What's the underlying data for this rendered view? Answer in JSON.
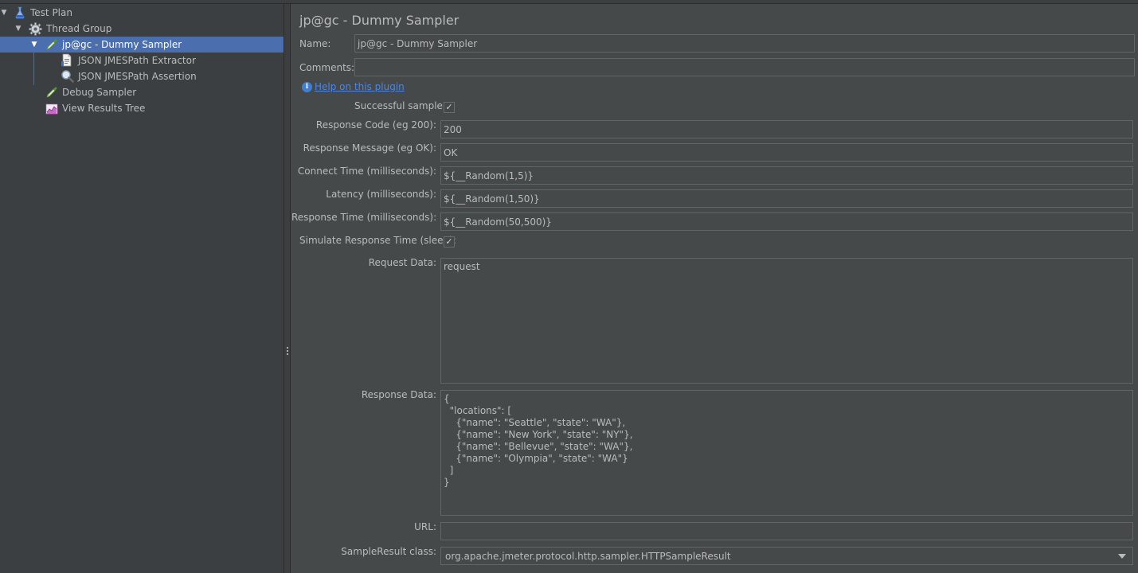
{
  "tree": {
    "items": [
      {
        "label": "Test Plan",
        "icon": "flask-icon"
      },
      {
        "label": "Thread Group",
        "icon": "gear-icon"
      },
      {
        "label": "jp@gc - Dummy Sampler",
        "icon": "pipette-icon",
        "selected": true
      },
      {
        "label": "JSON JMESPath Extractor",
        "icon": "document-icon"
      },
      {
        "label": "JSON JMESPath Assertion",
        "icon": "magnifier-icon"
      },
      {
        "label": "Debug Sampler",
        "icon": "pipette-icon"
      },
      {
        "label": "View Results Tree",
        "icon": "chart-icon"
      }
    ]
  },
  "form": {
    "title": "jp@gc - Dummy Sampler",
    "name_label": "Name:",
    "name_value": "jp@gc - Dummy Sampler",
    "comments_label": "Comments:",
    "comments_value": "",
    "help_link": "Help on this plugin",
    "successful_label": "Successful sample:",
    "successful_checked": true,
    "response_code_label": "Response Code (eg 200):",
    "response_code_value": "200",
    "response_message_label": "Response Message (eg OK):",
    "response_message_value": "OK",
    "connect_time_label": "Connect Time (milliseconds):",
    "connect_time_value": "${__Random(1,5)}",
    "latency_label": "Latency (milliseconds):",
    "latency_value": "${__Random(1,50)}",
    "response_time_label": "Response Time (milliseconds):",
    "response_time_value": "${__Random(50,500)}",
    "simulate_label": "Simulate Response Time (sleep):",
    "simulate_checked": true,
    "request_data_label": "Request Data:",
    "request_data_value": "request",
    "response_data_label": "Response Data:",
    "response_data_value": "{\n  \"locations\": [\n    {\"name\": \"Seattle\", \"state\": \"WA\"},\n    {\"name\": \"New York\", \"state\": \"NY\"},\n    {\"name\": \"Bellevue\", \"state\": \"WA\"},\n    {\"name\": \"Olympia\", \"state\": \"WA\"}\n  ]\n}",
    "url_label": "URL:",
    "url_value": "",
    "sample_result_label": "SampleResult class:",
    "sample_result_value": "org.apache.jmeter.protocol.http.sampler.HTTPSampleResult"
  },
  "colors": {
    "background": "#45494a",
    "tree_background": "#3c3f41",
    "selection": "#4b6eaf",
    "link": "#4a86e8"
  }
}
